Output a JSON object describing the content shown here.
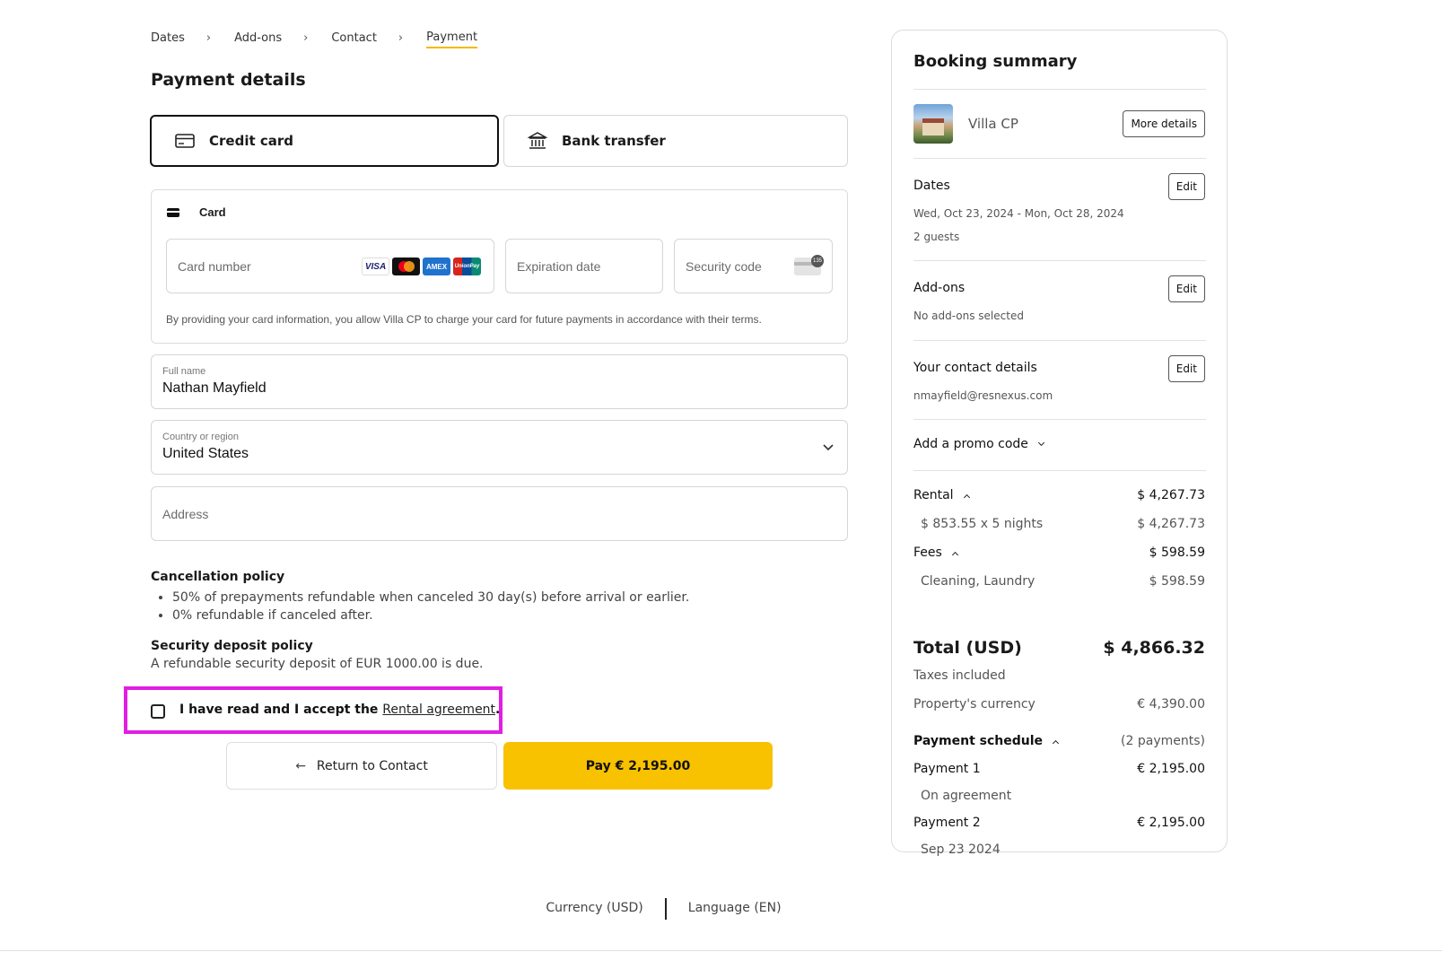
{
  "breadcrumb": {
    "items": [
      "Dates",
      "Add-ons",
      "Contact",
      "Payment"
    ],
    "separator": "›",
    "active": "Payment"
  },
  "payment": {
    "title": "Payment details",
    "tabs": [
      {
        "label": "Credit card",
        "icon": "credit-card-icon",
        "selected": true
      },
      {
        "label": "Bank transfer",
        "icon": "bank-icon",
        "selected": false
      }
    ],
    "card": {
      "title": "Card",
      "card_number_placeholder": "Card number",
      "expiration_placeholder": "Expiration date",
      "security_placeholder": "Security code",
      "brands": [
        "VISA",
        "AMEX",
        "UnionPay"
      ],
      "cvc_hint": "135",
      "note": "By providing your card information, you allow Villa CP to charge your card for future payments in accordance with their terms."
    },
    "full_name": {
      "label": "Full name",
      "value": "Nathan Mayfield"
    },
    "country": {
      "label": "Country or region",
      "value": "United States"
    },
    "address": {
      "placeholder": "Address"
    },
    "cancellation": {
      "title": "Cancellation policy",
      "items": [
        "50% of prepayments refundable when canceled 30 day(s) before arrival or earlier.",
        "0% refundable if canceled after."
      ]
    },
    "deposit": {
      "title": "Security deposit policy",
      "text": "A refundable security deposit of EUR 1000.00 is due."
    },
    "agreement": {
      "prefix": "I have read and I accept the ",
      "link": "Rental agreement",
      "suffix": ".",
      "checked": false
    },
    "buttons": {
      "return_label": "Return to Contact",
      "pay_label": "Pay € 2,195.00"
    }
  },
  "summary": {
    "title": "Booking summary",
    "property": {
      "name": "Villa CP",
      "more_details_label": "More details"
    },
    "edit_label": "Edit",
    "dates": {
      "label": "Dates",
      "range": "Wed, Oct 23, 2024 - Mon, Oct 28, 2024",
      "guests": "2 guests"
    },
    "addons": {
      "label": "Add-ons",
      "value": "No add-ons selected"
    },
    "contact": {
      "label": "Your contact details",
      "email": "nmayfield@resnexus.com"
    },
    "promo_label": "Add a promo code",
    "rental": {
      "label": "Rental",
      "amount": "$ 4,267.73",
      "detail": "$ 853.55 x 5 nights",
      "detail_amount": "$ 4,267.73"
    },
    "fees": {
      "label": "Fees",
      "amount": "$ 598.59",
      "detail": "Cleaning, Laundry",
      "detail_amount": "$ 598.59"
    },
    "total": {
      "label": "Total (USD)",
      "amount": "$ 4,866.32"
    },
    "taxes": "Taxes included",
    "property_currency": {
      "label": "Property's currency",
      "amount": "€ 4,390.00"
    },
    "schedule": {
      "label": "Payment schedule",
      "count": "(2 payments)",
      "payments": [
        {
          "label": "Payment 1",
          "amount": "€ 2,195.00",
          "when": "On agreement"
        },
        {
          "label": "Payment 2",
          "amount": "€ 2,195.00",
          "when": "Sep 23 2024"
        }
      ]
    }
  },
  "footer": {
    "currency": "Currency (USD)",
    "language": "Language (EN)"
  },
  "colors": {
    "accent": "#f8c200",
    "highlight": "#e21ee3",
    "text": "#1a1a1a",
    "border": "#d6d6d6"
  }
}
